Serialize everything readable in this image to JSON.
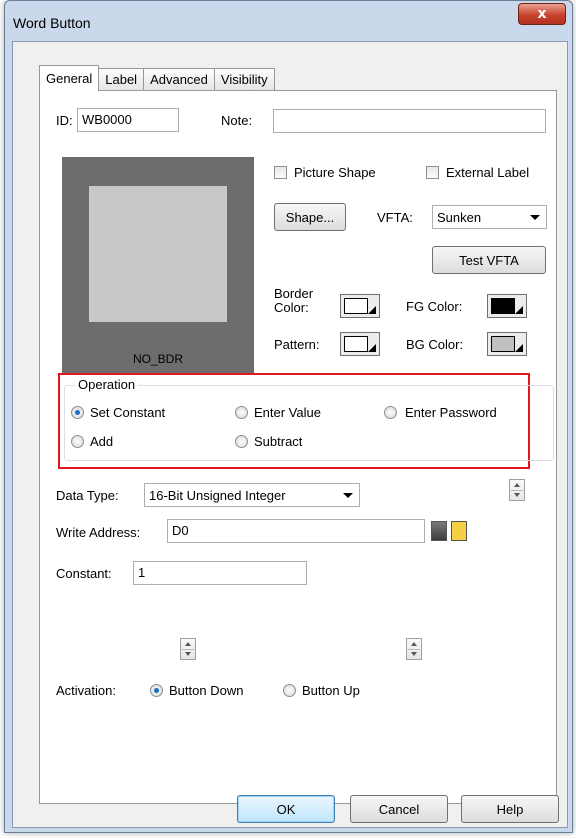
{
  "window": {
    "title": "Word Button",
    "close_glyph": "x"
  },
  "tabs": [
    {
      "label": "General",
      "active": true
    },
    {
      "label": "Label",
      "active": false
    },
    {
      "label": "Advanced",
      "active": false
    },
    {
      "label": "Visibility",
      "active": false
    }
  ],
  "general": {
    "id_label": "ID:",
    "id_value": "WB0000",
    "note_label": "Note:",
    "note_value": "",
    "preview_label": "NO_BDR",
    "picture_shape_label": "Picture Shape",
    "picture_shape_checked": false,
    "external_label_label": "External Label",
    "external_label_checked": false,
    "shape_button": "Shape...",
    "vfta_label": "VFTA:",
    "vfta_value": "Sunken",
    "test_vfta_button": "Test VFTA",
    "border_color_label": "Border Color:",
    "border_color_value": "#ffffff",
    "fg_color_label": "FG Color:",
    "fg_color_value": "#000000",
    "pattern_label": "Pattern:",
    "pattern_value": "#ffffff",
    "bg_color_label": "BG Color:",
    "bg_color_value": "#c0c0c0"
  },
  "operation": {
    "title": "Operation",
    "options": [
      {
        "label": "Set Constant",
        "checked": true
      },
      {
        "label": "Enter Value",
        "checked": false
      },
      {
        "label": "Enter Password",
        "checked": false
      },
      {
        "label": "Add",
        "checked": false
      },
      {
        "label": "Subtract",
        "checked": false
      }
    ]
  },
  "data_type": {
    "label": "Data Type:",
    "value": "16-Bit Unsigned Integer"
  },
  "write_address": {
    "label": "Write Address:",
    "value": "D0",
    "keypad_icon": "calculator-icon",
    "address_icon": "tag-icon"
  },
  "constant": {
    "label": "Constant:",
    "value": "1"
  },
  "activation": {
    "label": "Activation:",
    "options": [
      {
        "label": "Button Down",
        "checked": true
      },
      {
        "label": "Button Up",
        "checked": false
      }
    ]
  },
  "footer": {
    "ok": "OK",
    "cancel": "Cancel",
    "help": "Help"
  },
  "colors": {
    "highlight_border": "#e2161d",
    "radio_dot": "#1a6fc7"
  }
}
